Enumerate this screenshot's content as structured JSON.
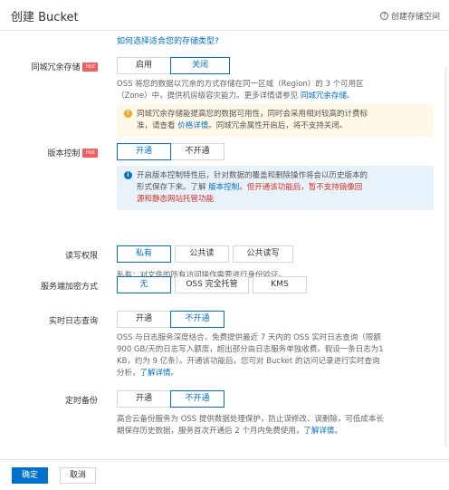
{
  "header": {
    "title": "创建 Bucket",
    "help_label": "创建存储空间",
    "help_icon": "question-circle-icon"
  },
  "storage_type_link": "如何选择适合您的存储类型?",
  "zone_redundancy": {
    "label": "同城冗余存储",
    "hot": "Hot",
    "options": [
      "启用",
      "关闭"
    ],
    "selected": "关闭",
    "desc_a": "OSS 将您的数据以冗余的方式存储在同一区域（Region）的 3 个可用区",
    "desc_b": "（Zone）中，提供机房级容灾能力。更多详情请参见 ",
    "desc_link": "同城冗余存储",
    "desc_end": "。",
    "warning_a": "同城冗余存储能提高您的数据可用性，同时会采用相对较高的计费标",
    "warning_b": "准，请查看 ",
    "warning_link": "价格详情",
    "warning_c": "。同城冗余属性开启后，将不支持关闭。"
  },
  "versioning": {
    "label": "版本控制",
    "hot": "Hot",
    "options": [
      "开通",
      "不开通"
    ],
    "selected": "开通",
    "info_a": "开启版本控制特性后，针对数据的覆盖和删除操作将会以历史版本的",
    "info_b": "形式保存下来。了解 ",
    "info_link": "版本控制",
    "info_red_a": "。但开通该功能后，暂不支持镜像回",
    "info_red_b": "源和静态网站托管功能"
  },
  "acl": {
    "label": "读写权限",
    "options": [
      "私有",
      "公共读",
      "公共读写"
    ],
    "selected": "私有",
    "desc": "私有：对文件的所有访问操作需要进行身份验证。"
  },
  "encryption": {
    "label": "服务端加密方式",
    "options": [
      "无",
      "OSS 完全托管",
      "KMS"
    ],
    "selected": "无"
  },
  "realtime_log": {
    "label": "实时日志查询",
    "options": [
      "开通",
      "不开通"
    ],
    "selected": "不开通",
    "desc_a": "OSS 与日志服务深度结合，免费提供最近 7 天内的 OSS 实时日志查询（限额",
    "desc_b": "900 GB/天的日志写入额度，超出部分由日志服务单独收费。假设一条日志为1",
    "desc_c": "KB，约为 9 亿条）。开通该功能后，您可对 Bucket 的访问记录进行实时查询",
    "desc_d": "分析，",
    "desc_link": "了解详情",
    "desc_end": "。"
  },
  "backup": {
    "label": "定时备份",
    "options": [
      "开通",
      "不开通"
    ],
    "selected": "不开通",
    "desc_a": "高合云备份服务为 OSS 提供数据处理保护，防止误修改、误删除，可低成本长",
    "desc_b": "期保存历史数据，服务首次开通后 2 个月内免费使用，",
    "desc_link": "了解详情",
    "desc_end": "。"
  },
  "footer": {
    "confirm": "确定",
    "cancel": "取消"
  }
}
